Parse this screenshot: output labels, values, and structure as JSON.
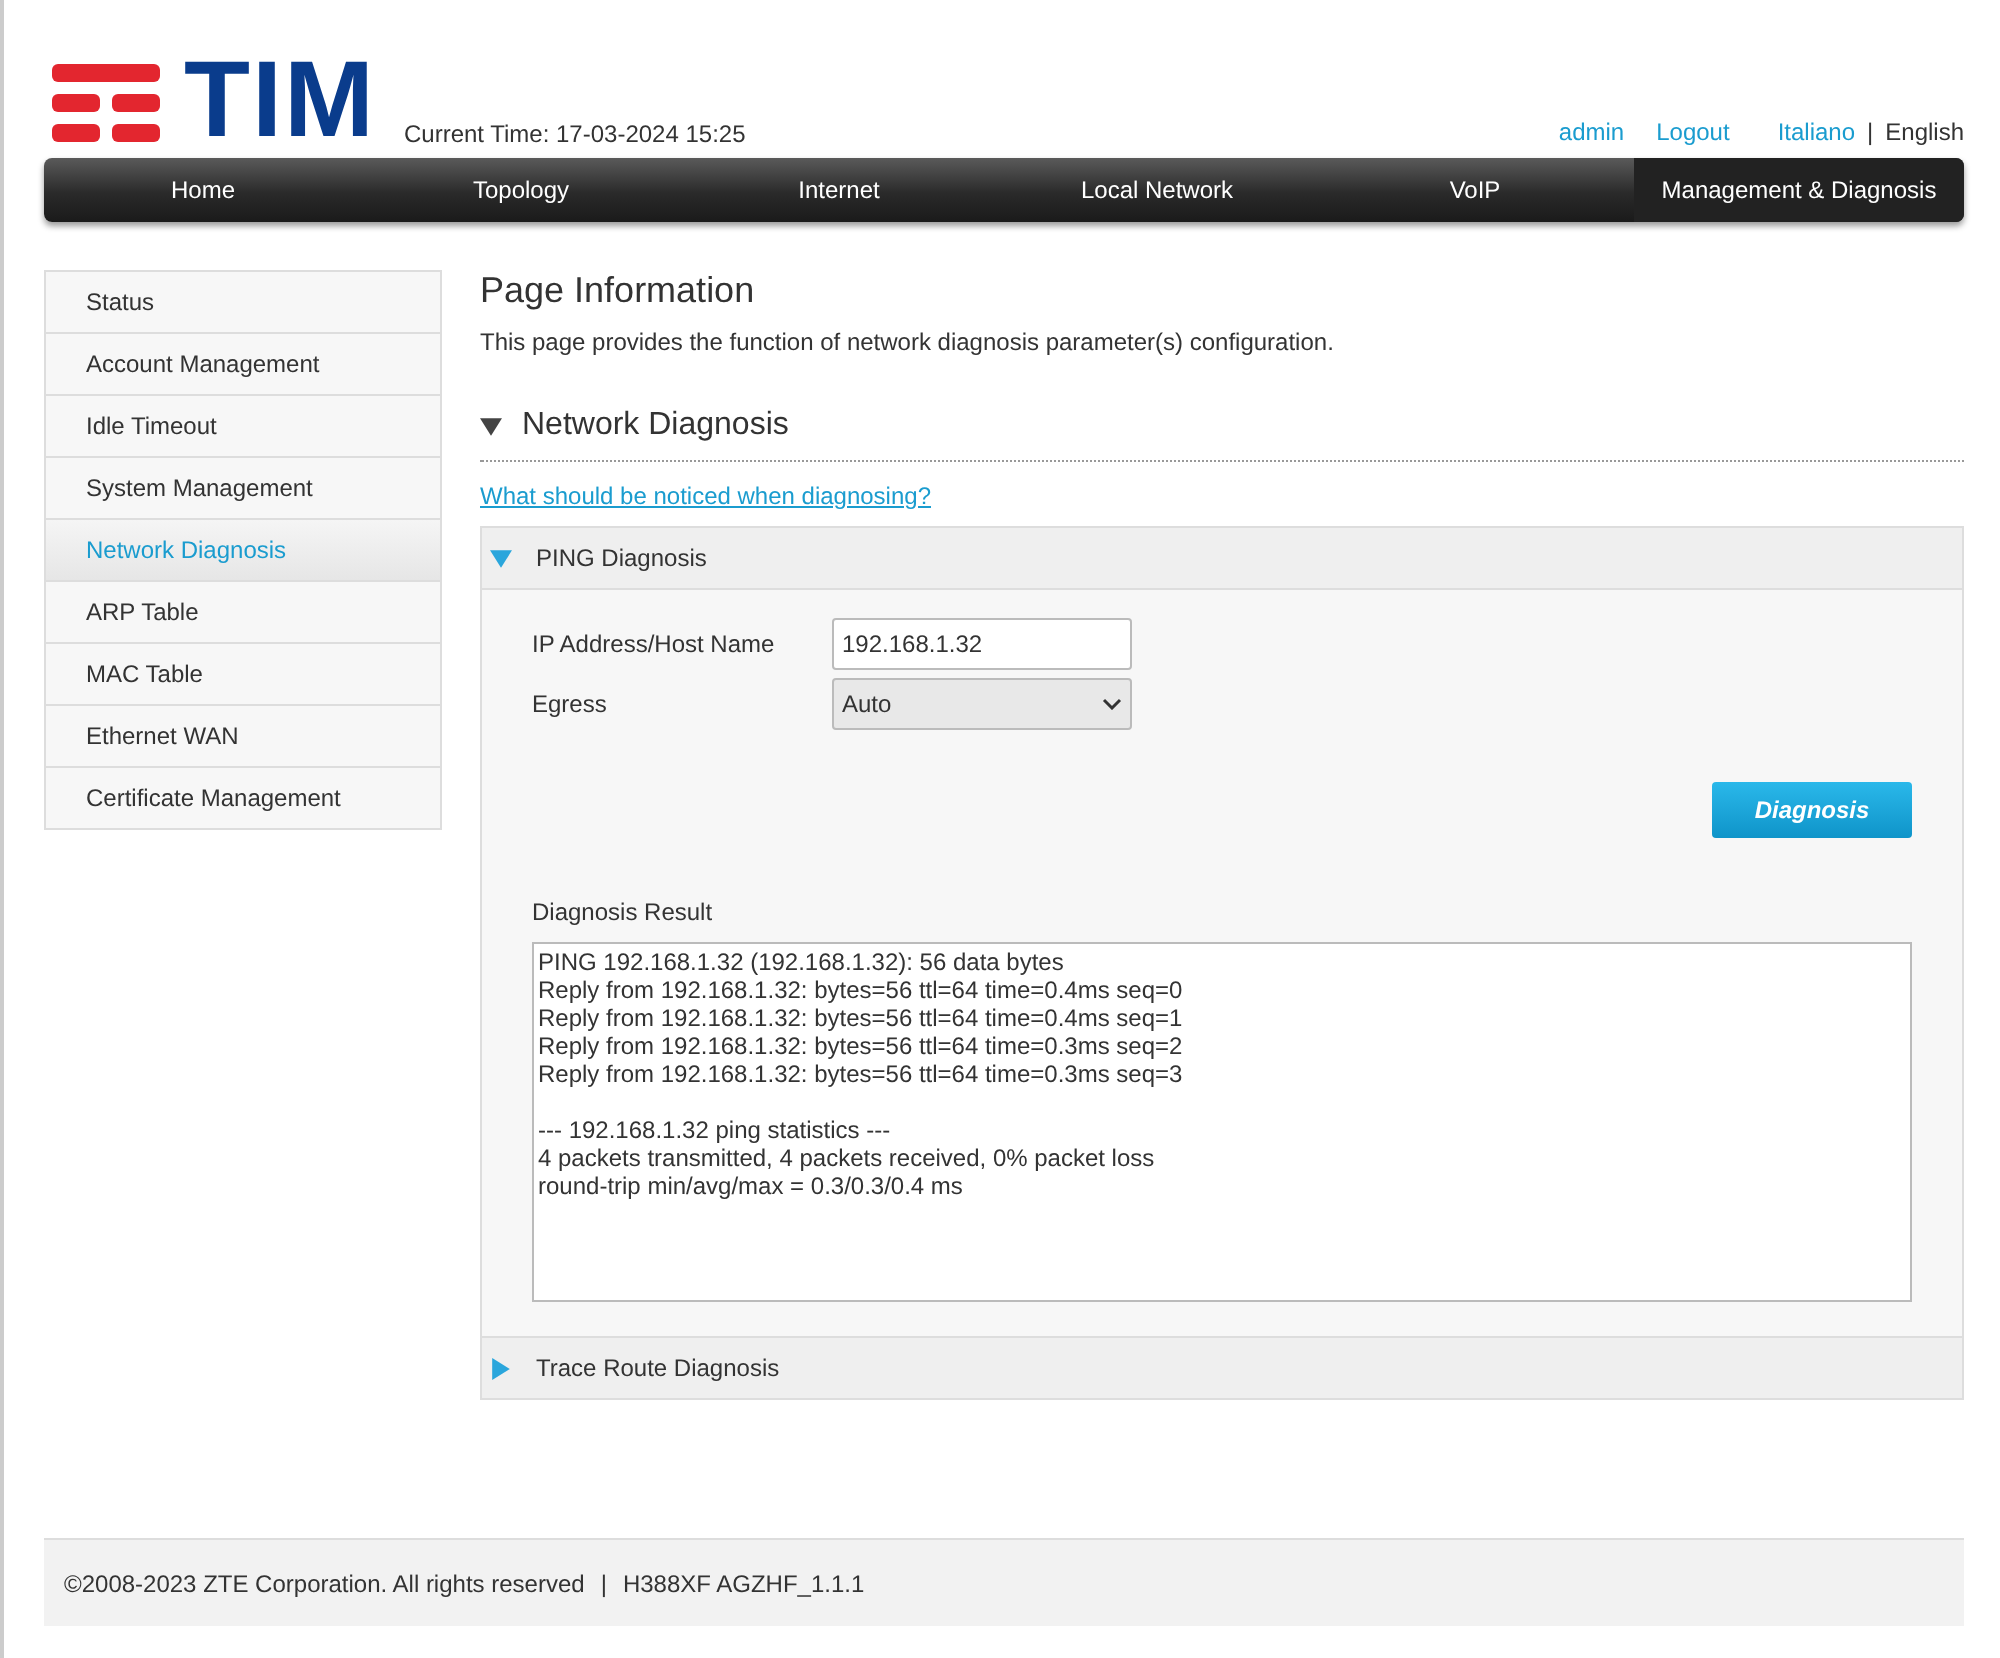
{
  "header": {
    "logo_text": "TIM",
    "current_time": "Current Time: 17-03-2024 15:25",
    "user": "admin",
    "logout": "Logout",
    "languages": [
      {
        "label": "Italiano",
        "selected": false
      },
      {
        "label": "English",
        "selected": true
      }
    ],
    "language_separator": "|"
  },
  "nav": [
    {
      "label": "Home",
      "selected": false
    },
    {
      "label": "Topology",
      "selected": false
    },
    {
      "label": "Internet",
      "selected": false
    },
    {
      "label": "Local Network",
      "selected": false
    },
    {
      "label": "VoIP",
      "selected": false
    },
    {
      "label": "Management & Diagnosis",
      "selected": true
    }
  ],
  "sidebar": {
    "items": [
      {
        "label": "Status",
        "selected": false
      },
      {
        "label": "Account Management",
        "selected": false
      },
      {
        "label": "Idle Timeout",
        "selected": false
      },
      {
        "label": "System Management",
        "selected": false
      },
      {
        "label": "Network Diagnosis",
        "selected": true
      },
      {
        "label": "ARP Table",
        "selected": false
      },
      {
        "label": "MAC Table",
        "selected": false
      },
      {
        "label": "Ethernet WAN",
        "selected": false
      },
      {
        "label": "Certificate Management",
        "selected": false
      }
    ]
  },
  "page_info": {
    "title": "Page Information",
    "description": "This page provides the function of network diagnosis parameter(s) configuration."
  },
  "section": {
    "title": "Network Diagnosis",
    "expanded": true,
    "help_link": "What should be noticed when diagnosing?"
  },
  "panels": [
    {
      "title": "PING Diagnosis",
      "expanded": true,
      "fields": [
        {
          "kind": "text",
          "label": "IP Address/Host Name",
          "value": "192.168.1.32"
        },
        {
          "kind": "select",
          "label": "Egress",
          "value": "Auto"
        }
      ],
      "button": "Diagnosis",
      "result_label": "Diagnosis Result",
      "result_blocks": [
        [
          "PING 192.168.1.32 (192.168.1.32): 56 data bytes",
          "Reply from 192.168.1.32: bytes=56 ttl=64 time=0.4ms seq=0",
          "Reply from 192.168.1.32: bytes=56 ttl=64 time=0.4ms seq=1",
          "Reply from 192.168.1.32: bytes=56 ttl=64 time=0.3ms seq=2",
          "Reply from 192.168.1.32: bytes=56 ttl=64 time=0.3ms seq=3"
        ],
        [
          "--- 192.168.1.32 ping statistics ---",
          "4 packets transmitted, 4 packets received, 0% packet loss",
          "round-trip min/avg/max = 0.3/0.3/0.4 ms"
        ]
      ]
    },
    {
      "title": "Trace Route Diagnosis",
      "expanded": false
    }
  ],
  "footer": {
    "copyright": "©2008-2023 ZTE Corporation. All rights reserved",
    "separator": "|",
    "version": "H388XF AGZHF_1.1.1"
  }
}
